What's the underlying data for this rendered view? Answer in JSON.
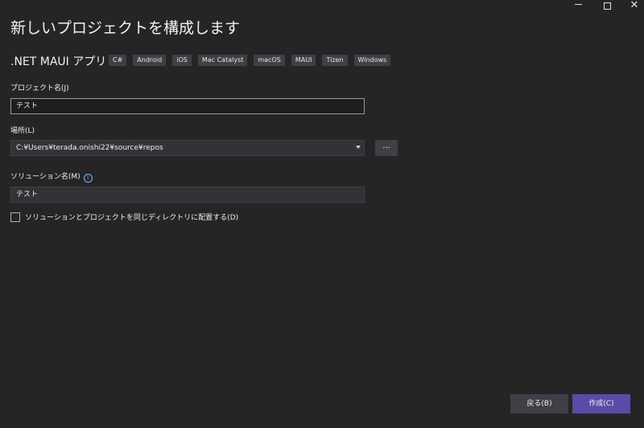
{
  "window": {
    "minimize_icon": "minimize-icon",
    "maximize_icon": "maximize-icon",
    "close_icon": "close-icon",
    "close_glyph": "✕"
  },
  "header": {
    "title": "新しいプロジェクトを構成します",
    "template_name": ".NET MAUI アプリ",
    "tags": [
      "C#",
      "Android",
      "iOS",
      "Mac Catalyst",
      "macOS",
      "MAUI",
      "Tizen",
      "Windows"
    ]
  },
  "form": {
    "project_name_label": "プロジェクト名(J)",
    "project_name_value": "テスト",
    "location_label": "場所(L)",
    "location_value": "C:¥Users¥terada.onishi22¥source¥repos",
    "browse_label": "...",
    "solution_name_label": "ソリューション名(M)",
    "solution_name_value": "テスト",
    "info_glyph": "i",
    "same_dir_checkbox_label": "ソリューションとプロジェクトを同じディレクトリに配置する(D)",
    "same_dir_checked": false
  },
  "footer": {
    "back_label": "戻る(B)",
    "create_label": "作成(C)"
  },
  "colors": {
    "background": "#252526",
    "accent_button": "#5b4aa8",
    "tag_background": "#3f3f46",
    "info_icon": "#75beff"
  }
}
